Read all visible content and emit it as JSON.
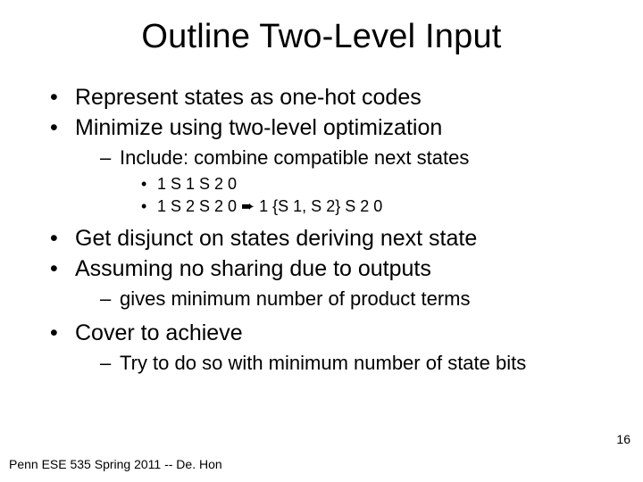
{
  "title": "Outline Two-Level Input",
  "bullets": {
    "b1": "Represent states as one-hot codes",
    "b2": "Minimize using two-level optimization",
    "b2_1": "Include: combine compatible next states",
    "b2_1_1": "1 S 1  S 2 0",
    "b2_1_2": "1 S 2  S 2 0  ➨  1 {S 1, S 2} S 2 0",
    "b3": "Get disjunct on states deriving next state",
    "b4": "Assuming no sharing due to outputs",
    "b4_1": "gives minimum number of product terms",
    "b5": "Cover to achieve",
    "b5_1": "Try to do so with minimum number of state bits"
  },
  "page_number": "16",
  "footer": "Penn ESE 535 Spring 2011 -- De. Hon"
}
